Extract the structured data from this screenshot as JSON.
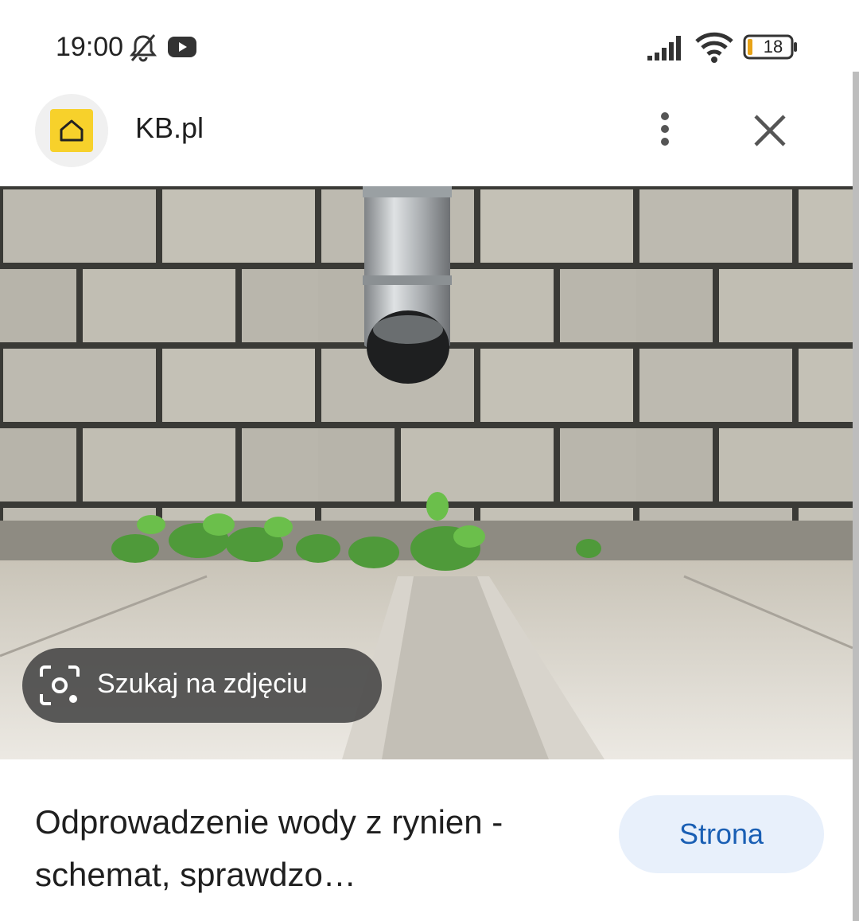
{
  "status_bar": {
    "time": "19:00",
    "battery": "18",
    "icons": [
      "bell-off-icon",
      "youtube-icon",
      "signal-icon",
      "wifi-icon",
      "battery-icon"
    ]
  },
  "header": {
    "site_name": "KB.pl",
    "favicon": "home-icon",
    "menu_icon": "more-vert-icon",
    "close_icon": "close-icon"
  },
  "image": {
    "lens_label": "Szukaj na zdjęciu",
    "lens_icon": "lens-icon"
  },
  "result": {
    "title": "Odprowadzenie wody z rynien - schemat, sprawdzo…",
    "visit_label": "Strona"
  },
  "colors": {
    "accent": "#1a5fb4",
    "button_bg": "#e8f0fb",
    "favicon": "#f7d12b",
    "chip_bg": "#444444"
  }
}
